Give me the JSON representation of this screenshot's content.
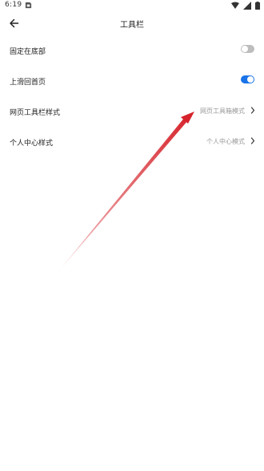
{
  "status_bar": {
    "time": "6:19",
    "notification_icon": "sim-card-icon",
    "wifi_icon": "wifi-icon",
    "signal_icon": "cell-signal-icon",
    "battery_icon": "battery-icon"
  },
  "header": {
    "title": "工具栏",
    "back_icon": "arrow-left-icon"
  },
  "settings": [
    {
      "label": "固定在底部",
      "type": "toggle",
      "checked": false
    },
    {
      "label": "上滑回首页",
      "type": "toggle",
      "checked": true
    },
    {
      "label": "网页工具栏样式",
      "type": "link",
      "value": "网页工具箱模式",
      "chevron_icon": "chevron-right-icon"
    },
    {
      "label": "个人中心样式",
      "type": "link",
      "value": "个人中心模式",
      "chevron_icon": "chevron-right-icon"
    }
  ],
  "colors": {
    "toggle_on": "#1a73e8",
    "toggle_off": "#bdbdbd",
    "annotation_arrow": "#d6232b",
    "value_text": "#999999"
  }
}
